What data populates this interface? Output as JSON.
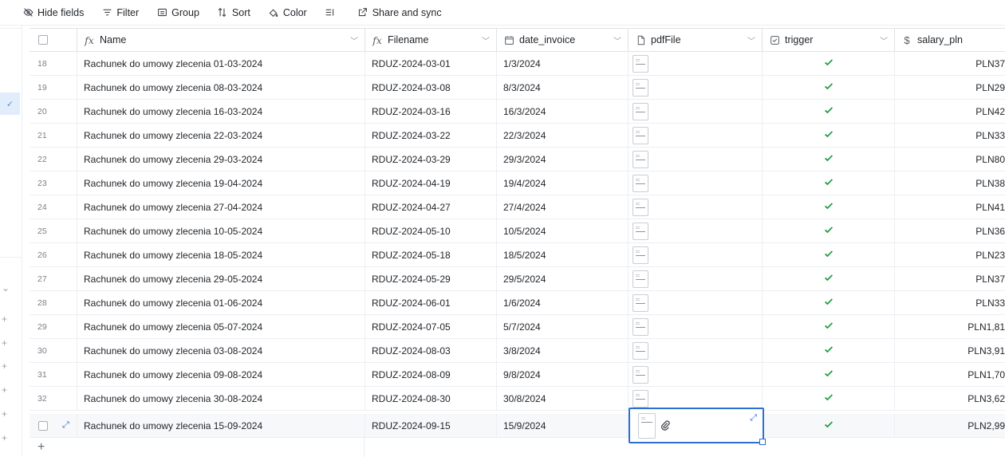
{
  "toolbar": {
    "hide_fields": "Hide fields",
    "filter": "Filter",
    "group": "Group",
    "sort": "Sort",
    "color": "Color",
    "share": "Share and sync"
  },
  "columns": {
    "name": "Name",
    "filename": "Filename",
    "date_invoice": "date_invoice",
    "pdffile": "pdfFile",
    "trigger": "trigger",
    "salary": "salary_pln"
  },
  "rows": [
    {
      "num": "18",
      "name": "Rachunek do umowy zlecenia 01-03-2024",
      "filename": "RDUZ-2024-03-01",
      "date": "1/3/2024",
      "salary": "PLN37"
    },
    {
      "num": "19",
      "name": "Rachunek do umowy zlecenia 08-03-2024",
      "filename": "RDUZ-2024-03-08",
      "date": "8/3/2024",
      "salary": "PLN29"
    },
    {
      "num": "20",
      "name": "Rachunek do umowy zlecenia 16-03-2024",
      "filename": "RDUZ-2024-03-16",
      "date": "16/3/2024",
      "salary": "PLN42"
    },
    {
      "num": "21",
      "name": "Rachunek do umowy zlecenia 22-03-2024",
      "filename": "RDUZ-2024-03-22",
      "date": "22/3/2024",
      "salary": "PLN33"
    },
    {
      "num": "22",
      "name": "Rachunek do umowy zlecenia 29-03-2024",
      "filename": "RDUZ-2024-03-29",
      "date": "29/3/2024",
      "salary": "PLN80"
    },
    {
      "num": "23",
      "name": "Rachunek do umowy zlecenia 19-04-2024",
      "filename": "RDUZ-2024-04-19",
      "date": "19/4/2024",
      "salary": "PLN38"
    },
    {
      "num": "24",
      "name": "Rachunek do umowy zlecenia 27-04-2024",
      "filename": "RDUZ-2024-04-27",
      "date": "27/4/2024",
      "salary": "PLN41"
    },
    {
      "num": "25",
      "name": "Rachunek do umowy zlecenia 10-05-2024",
      "filename": "RDUZ-2024-05-10",
      "date": "10/5/2024",
      "salary": "PLN36"
    },
    {
      "num": "26",
      "name": "Rachunek do umowy zlecenia 18-05-2024",
      "filename": "RDUZ-2024-05-18",
      "date": "18/5/2024",
      "salary": "PLN23"
    },
    {
      "num": "27",
      "name": "Rachunek do umowy zlecenia 29-05-2024",
      "filename": "RDUZ-2024-05-29",
      "date": "29/5/2024",
      "salary": "PLN37"
    },
    {
      "num": "28",
      "name": "Rachunek do umowy zlecenia 01-06-2024",
      "filename": "RDUZ-2024-06-01",
      "date": "1/6/2024",
      "salary": "PLN33"
    },
    {
      "num": "29",
      "name": "Rachunek do umowy zlecenia 05-07-2024",
      "filename": "RDUZ-2024-07-05",
      "date": "5/7/2024",
      "salary": "PLN1,81"
    },
    {
      "num": "30",
      "name": "Rachunek do umowy zlecenia 03-08-2024",
      "filename": "RDUZ-2024-08-03",
      "date": "3/8/2024",
      "salary": "PLN3,91"
    },
    {
      "num": "31",
      "name": "Rachunek do umowy zlecenia 09-08-2024",
      "filename": "RDUZ-2024-08-09",
      "date": "9/8/2024",
      "salary": "PLN1,70"
    },
    {
      "num": "32",
      "name": "Rachunek do umowy zlecenia 30-08-2024",
      "filename": "RDUZ-2024-08-30",
      "date": "30/8/2024",
      "salary": "PLN3,62"
    }
  ],
  "active_row": {
    "name": "Rachunek do umowy zlecenia 15-09-2024",
    "filename": "RDUZ-2024-09-15",
    "date": "15/9/2024",
    "salary": "PLN2,99"
  },
  "add_row_label": "+",
  "colors": {
    "accent": "#2d6fd2",
    "check_green": "#1a9c3c",
    "selection_bg": "#e2edfb"
  },
  "icons": {
    "name_field": "formula-icon",
    "filename_field": "formula-icon",
    "date_field": "calendar-icon",
    "pdf_field": "document-icon",
    "trigger_field": "checkbox-icon",
    "salary_field": "currency-icon"
  }
}
